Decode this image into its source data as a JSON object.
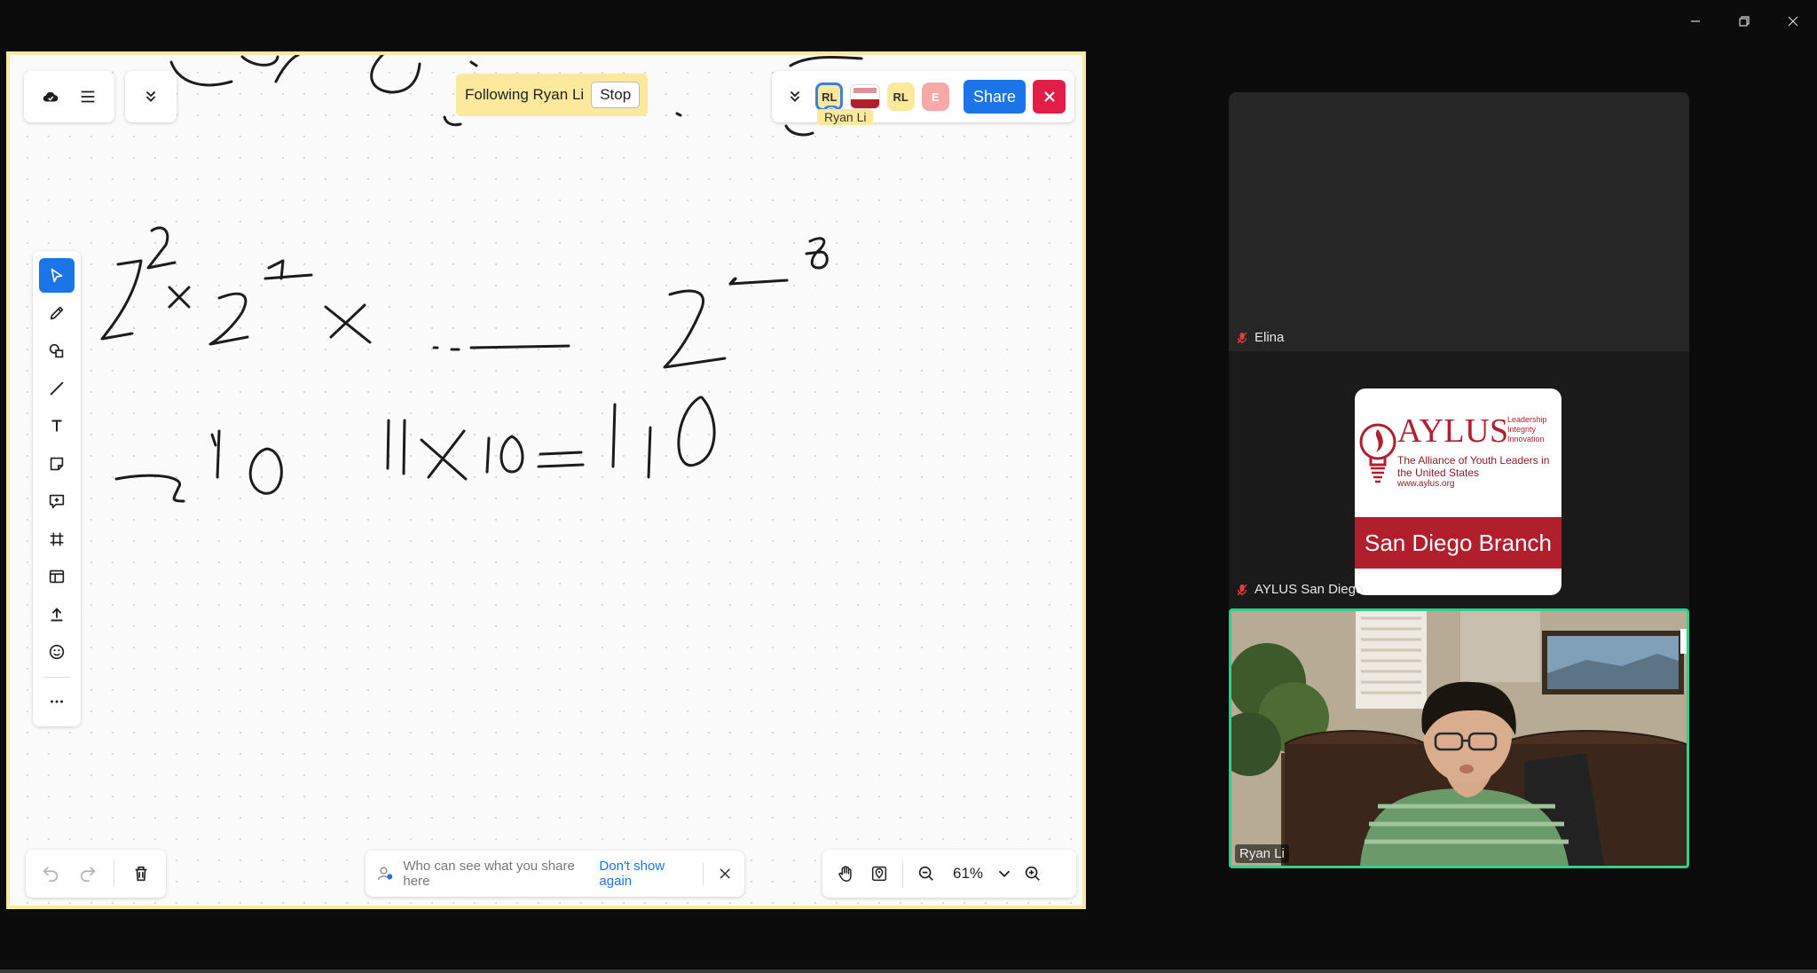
{
  "window": {
    "controls": [
      "minimize-icon",
      "restore-icon",
      "close-icon"
    ]
  },
  "board": {
    "follow_banner": {
      "text": "Following Ryan Li",
      "stop_label": "Stop"
    },
    "follow_tag": "Ryan Li",
    "collaborators": [
      {
        "initials": "RL",
        "color": "#fde99b",
        "following": true
      },
      {
        "initials": "",
        "image": "aylus-logo"
      },
      {
        "initials": "RL",
        "color": "#fde99b"
      },
      {
        "initials": "E",
        "color": "#f6aaa8"
      }
    ],
    "share_label": "Share",
    "tools": [
      "select-icon",
      "pencil-icon",
      "shapes-icon",
      "line-icon",
      "text-icon",
      "sticky-note-icon",
      "comment-icon",
      "frame-icon",
      "template-icon",
      "upload-icon",
      "emoji-icon",
      "more-icon"
    ],
    "active_tool": "select-icon",
    "privacy": {
      "text": "Who can see what you share here",
      "link": "Don't show again"
    },
    "zoom": {
      "level": "61%"
    },
    "accent": "#1b74e8",
    "frame_color": "#fbe7a1"
  },
  "participants": [
    {
      "name": "Elina",
      "muted": true
    },
    {
      "name": "AYLUS San Diego",
      "muted": true,
      "logo": {
        "title": "AYLUS",
        "motto": [
          "Leadership",
          "Integrity",
          "Innovation"
        ],
        "tagline": "The Alliance of Youth Leaders in the United States",
        "url": "www.aylus.org",
        "banner": "San Diego Branch"
      }
    },
    {
      "name": "Ryan Li",
      "muted": false,
      "active_speaker": true,
      "highlight": "#2fd08a"
    }
  ]
}
